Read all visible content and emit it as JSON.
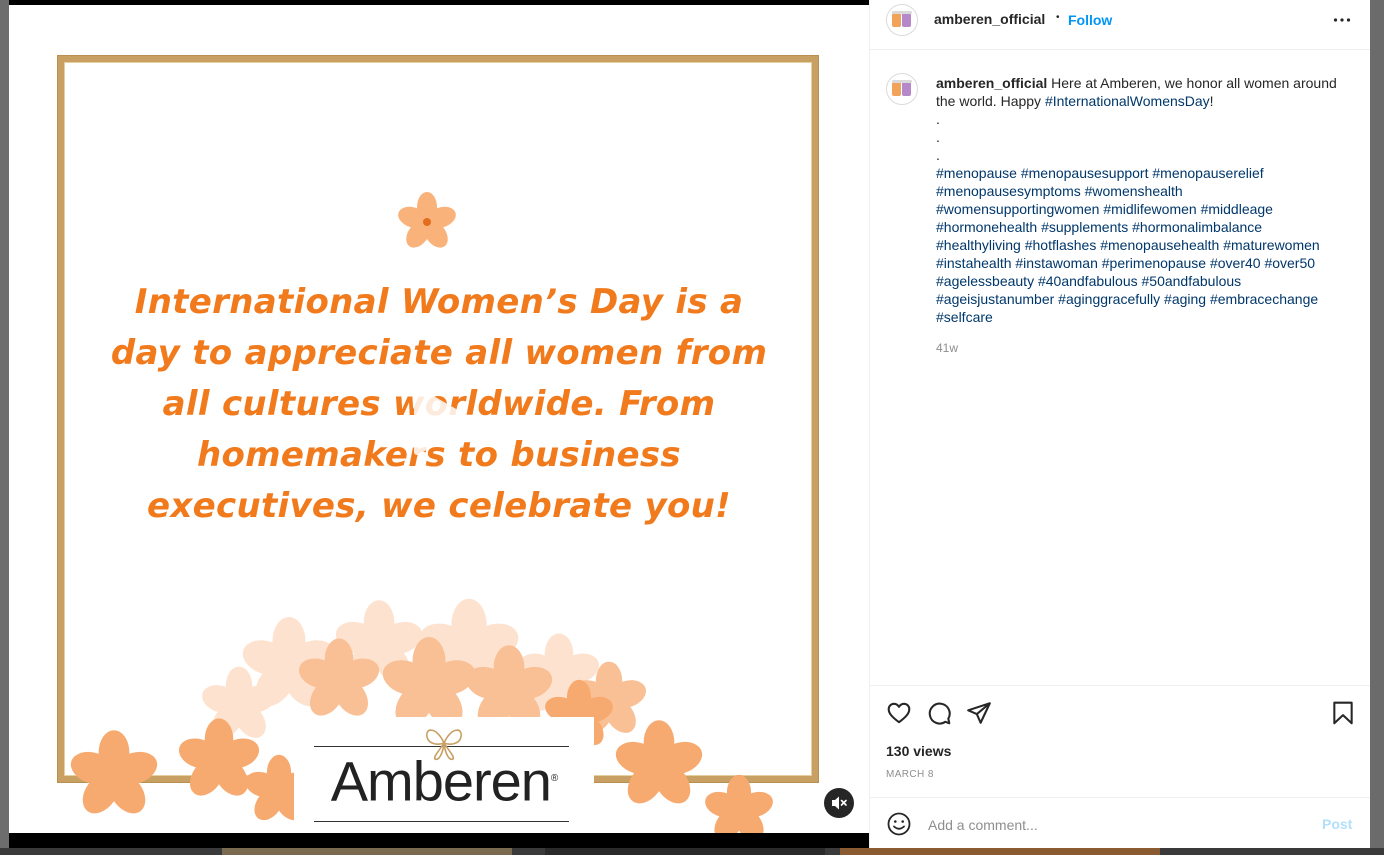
{
  "post": {
    "username": "amberen_official",
    "separator": "•",
    "follow_label": "Follow",
    "more_icon": "more-horizontal-icon"
  },
  "media": {
    "headline": "International Women’s Day is a day to appreciate all women from all cultures worldwide. From homemakers to business executives, we celebrate you!",
    "brand_logo": "Amberen",
    "brand_mark": "®",
    "colors": {
      "headline": "#f07a1c",
      "frame": "#c9a064",
      "flower": "#f9b27a"
    }
  },
  "caption": {
    "username": "amberen_official",
    "text": "Here at Amberen, we honor all women around the world. Happy",
    "lead_hashtag": "#InternationalWomensDay",
    "end_punct": "!",
    "dots": [
      ".",
      ".",
      "."
    ],
    "hashtag_lines": [
      "#menopause #menopausesupport #menopauserelief",
      "#menopausesymptoms #womenshealth",
      "#womensupportingwomen #midlifewomen #middleage",
      "#hormonehealth #supplements #hormonalimbalance",
      "#healthyliving #hotflashes #menopausehealth #maturewomen",
      "#instahealth #instawoman #perimenopause #over40 #over50",
      "#agelessbeauty #40andfabulous #50andfabulous",
      "#ageisjustanumber #aginggracefully #aging #embracechange",
      "#selfcare"
    ],
    "time_ago": "41w"
  },
  "actions": {
    "views": "130 views",
    "date": "MARCH 8"
  },
  "comment": {
    "placeholder": "Add a comment...",
    "post_label": "Post"
  },
  "colors": {
    "link": "#0095f6",
    "hashtag": "#00376b",
    "muted": "#8e8e8e",
    "post_disabled": "#b2dffc"
  }
}
